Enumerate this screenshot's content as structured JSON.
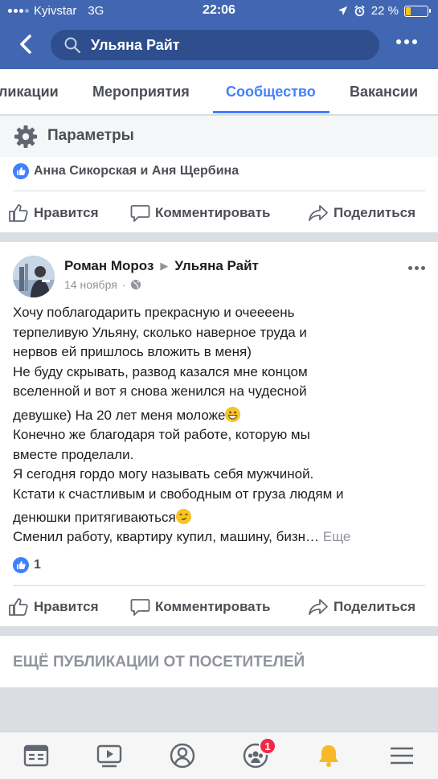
{
  "status_bar": {
    "carrier": "Kyivstar",
    "network": "3G",
    "time": "22:06",
    "battery": "22 %"
  },
  "header": {
    "search_value": "Ульяна Райт"
  },
  "tabs": [
    {
      "label": "ликации",
      "active": false
    },
    {
      "label": "Мероприятия",
      "active": false
    },
    {
      "label": "Сообщество",
      "active": true
    },
    {
      "label": "Вакансии",
      "active": false
    }
  ],
  "settings": {
    "label": "Параметры"
  },
  "prev_post": {
    "likers": "Анна Сикорская и Аня Щербина",
    "actions": {
      "like": "Нравится",
      "comment": "Комментировать",
      "share": "Поделиться"
    }
  },
  "post": {
    "author": "Роман Мороз",
    "target": "Ульяна Райт",
    "date": "14 ноября",
    "lines": [
      "Хочу поблагодарить прекрасную и очееeень",
      "терпеливую Ульяну, сколько наверное труда и",
      "нервов ей пришлось вложить в меня)",
      "Не буду скрывать, развод казался мне концом",
      "вселенной и вот я снова женился на чудесной",
      "девушке) На 20 лет меня моложе",
      "Конечно же благодаря той работе, которую мы",
      "вместе проделали.",
      "Я сегодня гордо могу называть себя мужчиной.",
      "Кстати к счастливым и свободным от груза людям и",
      "денюшки притягиваються",
      "Сменил работу, квартиру купил, машину, бизн…"
    ],
    "see_more": "Еще",
    "like_count": "1",
    "actions": {
      "like": "Нравится",
      "comment": "Комментировать",
      "share": "Поделиться"
    }
  },
  "more_section": {
    "title": "ЕЩЁ ПУБЛИКАЦИИ ОТ ПОСЕТИТЕЛЕЙ"
  },
  "bottom_nav": {
    "groups_badge": "1"
  },
  "colors": {
    "brand": "#4267b2",
    "accent": "#4080ff",
    "badge": "#f02849"
  }
}
